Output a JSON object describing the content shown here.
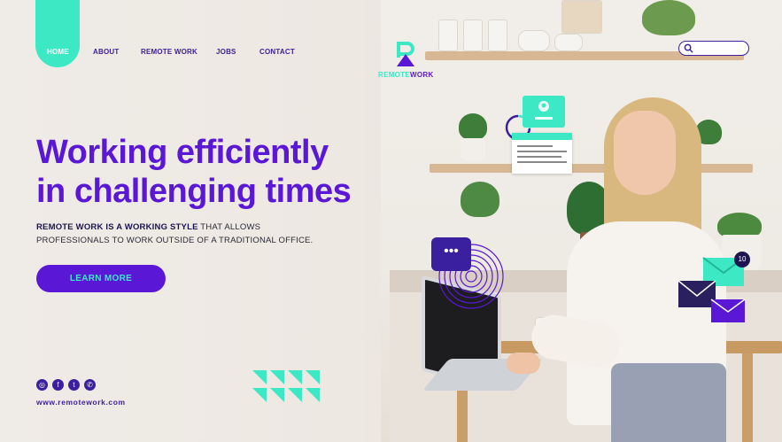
{
  "nav": {
    "items": [
      {
        "label": "HOME"
      },
      {
        "label": "ABOUT"
      },
      {
        "label": "REMOTE WORK"
      },
      {
        "label": "JOBS"
      },
      {
        "label": "CONTACT"
      }
    ],
    "active": "HOME"
  },
  "brand": {
    "mark_letter": "R",
    "name_part1": "REMOTE",
    "name_part2": "WORK"
  },
  "search": {
    "placeholder": "",
    "value": ""
  },
  "hero": {
    "headline_line1": "Working efficiently",
    "headline_line2": "in challenging times",
    "description_bold": "REMOTE WORK IS A WORKING STYLE",
    "description_rest": " THAT ALLOWS",
    "description_line2": "PROFESSIONALS TO WORK OUTSIDE OF A TRADITIONAL OFFICE.",
    "cta_label": "LEARN MORE"
  },
  "footer": {
    "socials": [
      {
        "icon": "instagram-icon",
        "glyph": "◎"
      },
      {
        "icon": "facebook-icon",
        "glyph": "f"
      },
      {
        "icon": "twitter-icon",
        "glyph": "t"
      },
      {
        "icon": "whatsapp-icon",
        "glyph": "✆"
      }
    ],
    "url": "www.remotework.com"
  },
  "graphics": {
    "chat_glyph": "•••",
    "notification_count": "10"
  },
  "colors": {
    "primary": "#5a17d6",
    "accent": "#3de8c5",
    "dark": "#3a1f9e",
    "navy": "#1c1550"
  }
}
